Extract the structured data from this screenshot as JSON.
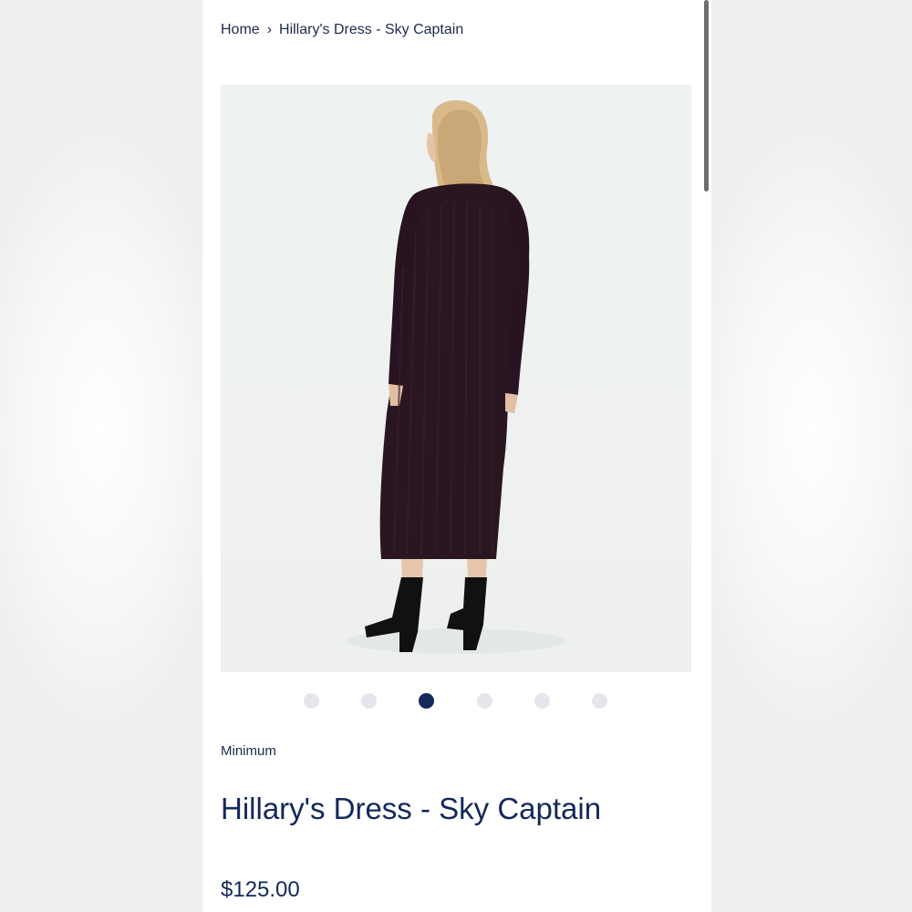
{
  "breadcrumb": {
    "home": "Home",
    "separator": "›",
    "current": "Hillary's Dress - Sky Captain"
  },
  "product": {
    "image_alt": "Model wearing Hillary's Dress - Sky Captain, rear view",
    "vendor": "Minimum",
    "title": "Hillary's Dress - Sky Captain",
    "price": "$125.00"
  },
  "carousel": {
    "total": 6,
    "active_index": 2
  },
  "colors": {
    "navy": "#13285a",
    "dot_inactive": "#e4e6ec",
    "dot_active": "#12295a",
    "dress": "#2a1620"
  }
}
